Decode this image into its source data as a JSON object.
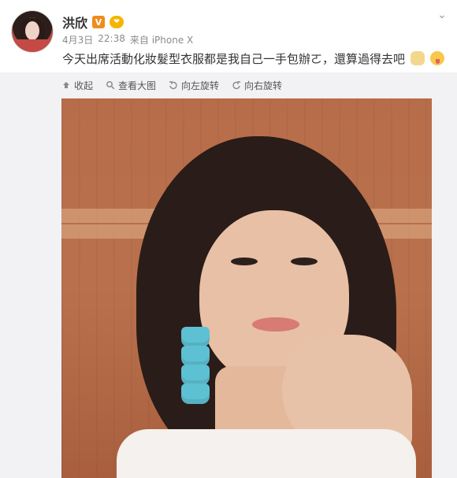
{
  "post": {
    "user_name": "洪欣",
    "verified_badge": "V",
    "date": "4月3日",
    "time": "22:38",
    "source": "来自 iPhone X",
    "text": "今天出席活動化妝髮型衣服都是我自己一手包辦ㄛ，還算過得去吧"
  },
  "toolbar": {
    "collapse_label": "收起",
    "view_large_label": "查看大图",
    "rotate_left_label": "向左旋转",
    "rotate_right_label": "向右旋转"
  },
  "colors": {
    "accent_orange": "#f08b1c",
    "panel_bg": "#f2f2f5",
    "text_dark": "#333333",
    "text_muted": "#8b8b8b"
  },
  "icons": {
    "verified": "verified-badge-icon",
    "member": "member-icon",
    "collapse": "collapse-icon",
    "search": "search-icon",
    "rotate_left": "rotate-left-icon",
    "rotate_right": "rotate-right-icon",
    "chevron": "chevron-down-icon"
  }
}
